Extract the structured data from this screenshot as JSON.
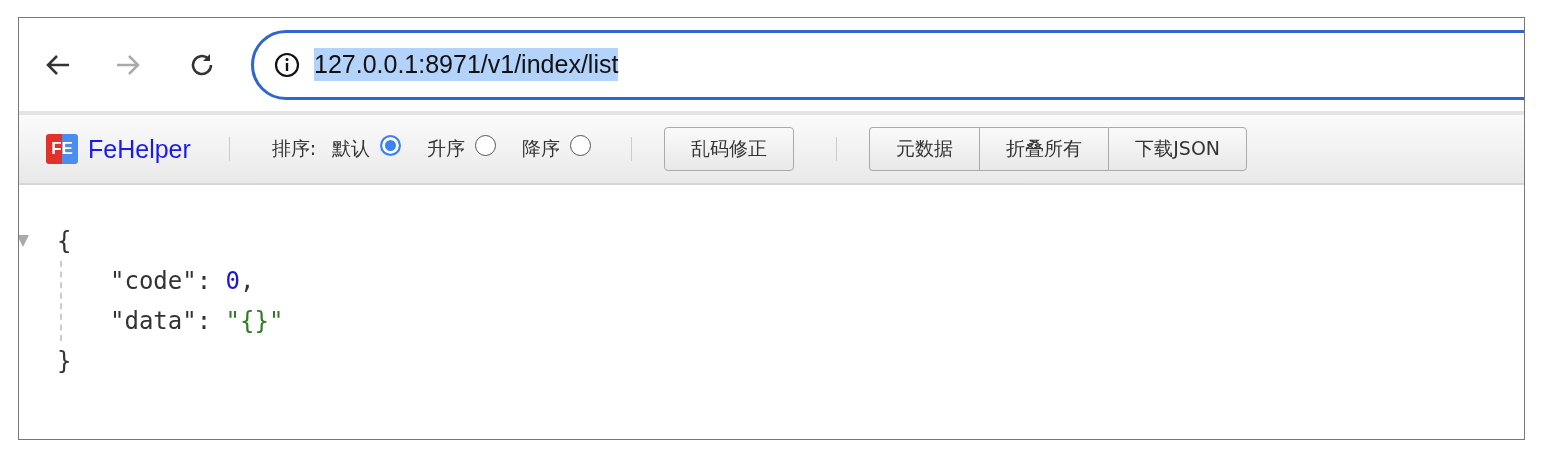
{
  "address_bar": {
    "url": "127.0.0.1:8971/v1/index/list",
    "selected": true
  },
  "fehelper_bar": {
    "logo_text": "FE",
    "brand": "FeHelper",
    "sort_label": "排序:",
    "sort_options": [
      {
        "label": "默认",
        "selected": true
      },
      {
        "label": "升序",
        "selected": false
      },
      {
        "label": "降序",
        "selected": false
      }
    ],
    "fix_button": "乱码修正",
    "button_group": [
      "元数据",
      "折叠所有",
      "下载JSON"
    ]
  },
  "json_view": {
    "expanded": true,
    "open": "{",
    "close": "}",
    "entries": [
      {
        "key": "\"code\"",
        "colon": ":",
        "value": "0",
        "kind": "number",
        "comma": ","
      },
      {
        "key": "\"data\"",
        "colon": ":",
        "value": "\"{}\"",
        "kind": "string"
      }
    ]
  }
}
